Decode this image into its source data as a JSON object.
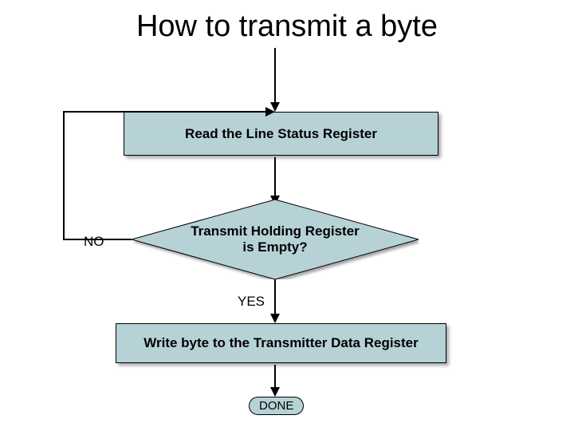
{
  "title": "How to transmit a byte",
  "flow": {
    "read_status": "Read the Line Status Register",
    "decision": "Transmit Holding Register\nis Empty?",
    "no_label": "NO",
    "yes_label": "YES",
    "write_byte": "Write byte to the Transmitter Data Register",
    "done": "DONE"
  },
  "colors": {
    "fill": "#b7d2d7",
    "stroke": "#000000"
  }
}
